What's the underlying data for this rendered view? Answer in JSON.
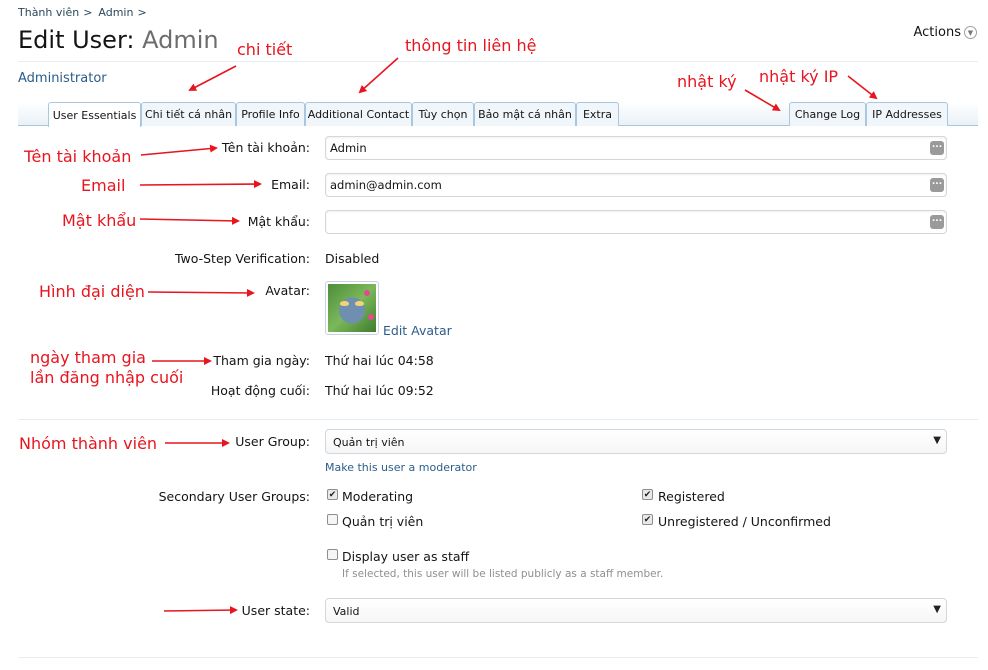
{
  "breadcrumb": {
    "items": [
      "Thành viên",
      "Admin"
    ]
  },
  "header": {
    "title_prefix": "Edit User:",
    "title_name": "Admin",
    "actions_label": "Actions",
    "role": "Administrator"
  },
  "tabs": {
    "left": [
      "User Essentials",
      "Chi tiết cá nhân",
      "Profile Info",
      "Additional Contact",
      "Tùy chọn",
      "Bảo mật cá nhân",
      "Extra"
    ],
    "right": [
      "Change Log",
      "IP Addresses"
    ]
  },
  "form": {
    "username_label": "Tên tài khoản:",
    "username_value": "Admin",
    "email_label": "Email:",
    "email_value": "admin@admin.com",
    "password_label": "Mật khẩu:",
    "password_value": "",
    "two_step_label": "Two-Step Verification:",
    "two_step_value": "Disabled",
    "avatar_label": "Avatar:",
    "edit_avatar_link": "Edit Avatar",
    "joined_label": "Tham gia ngày:",
    "joined_value": "Thứ hai lúc 04:58",
    "last_activity_label": "Hoạt động cuối:",
    "last_activity_value": "Thứ hai lúc 09:52",
    "user_group_label": "User Group:",
    "user_group_value": "Quản trị viên",
    "make_moderator_link": "Make this user a moderator",
    "secondary_groups_label": "Secondary User Groups:",
    "secondary_groups": [
      {
        "label": "Moderating",
        "checked": true
      },
      {
        "label": "Registered",
        "checked": true
      },
      {
        "label": "Quản trị viên",
        "checked": false
      },
      {
        "label": "Unregistered / Unconfirmed",
        "checked": true
      }
    ],
    "display_staff_label": "Display user as staff",
    "display_staff_checked": false,
    "display_staff_hint": "If selected, this user will be listed publicly as a staff member.",
    "user_state_label": "User state:",
    "user_state_value": "Valid"
  },
  "annotations": {
    "details": "chi tiết",
    "contact": "thông tin liên hệ",
    "log": "nhật ký",
    "ip_log": "nhật ký IP",
    "username": "Tên tài khoản",
    "email": "Email",
    "password": "Mật khẩu",
    "avatar": "Hình đại diện",
    "joined": "ngày tham gia",
    "last_login": "lần đăng nhập cuối",
    "group": "Nhóm thành viên"
  },
  "colors": {
    "annotation": "#e8141e",
    "link": "#2b5d8a",
    "tab_border": "#a9c7de"
  },
  "icons": {
    "actions_menu": "chevron-down-icon",
    "field_menu": "more-dots-icon",
    "check": "checkmark-icon",
    "select_arrow": "triangle-down-icon"
  }
}
